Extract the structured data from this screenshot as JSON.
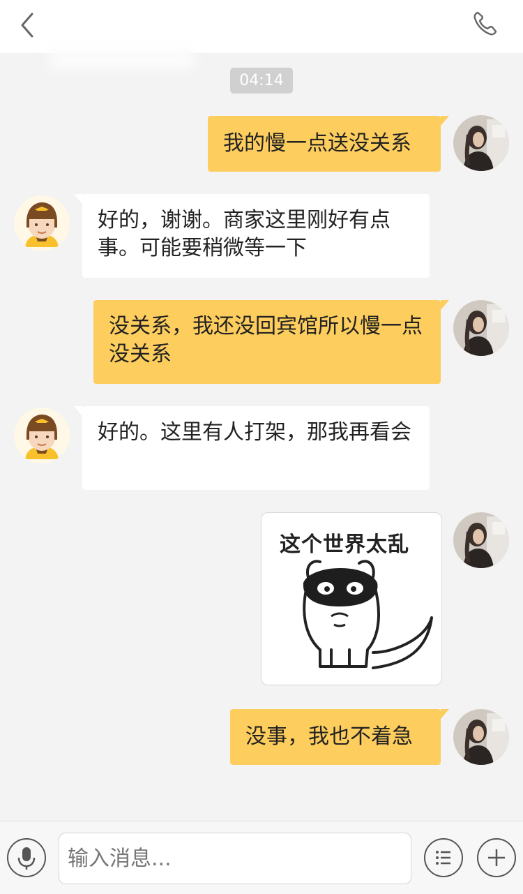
{
  "header": {
    "title": "",
    "back_icon": "chevron-left-icon",
    "call_icon": "phone-icon"
  },
  "timestamp": "04:14",
  "messages": [
    {
      "sender": "me",
      "type": "text",
      "text": "我的慢一点送没关系"
    },
    {
      "sender": "other",
      "type": "text",
      "text": "好的，谢谢。商家这里刚好有点事。可能要稍微等一下"
    },
    {
      "sender": "me",
      "type": "text",
      "text": "没关系，我还没回宾馆所以慢一点没关系"
    },
    {
      "sender": "other",
      "type": "text",
      "text": "好的。这里有人打架，那我再看会"
    },
    {
      "sender": "me",
      "type": "sticker",
      "text": "这个世界太乱"
    },
    {
      "sender": "me",
      "type": "text",
      "text": "没事，我也不着急"
    }
  ],
  "input": {
    "placeholder": "输入消息...",
    "voice_icon": "microphone-icon",
    "menu_icon": "list-icon",
    "add_icon": "plus-icon"
  },
  "colors": {
    "my_bubble": "#fdcd5d",
    "other_bubble": "#ffffff",
    "background": "#f3f3f3"
  }
}
